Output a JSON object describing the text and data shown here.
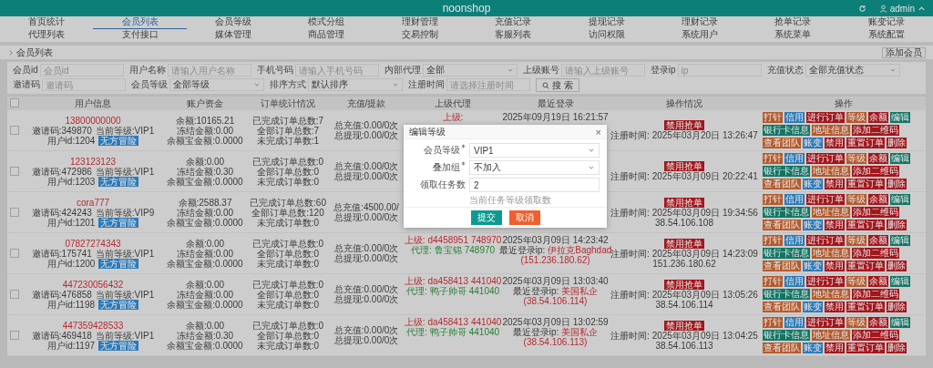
{
  "header": {
    "brand": "noonshop",
    "user": "admin"
  },
  "nav": [
    {
      "label": "首页统计",
      "selected": false
    },
    {
      "label": "会员列表",
      "selected": true
    },
    {
      "label": "会员等级",
      "selected": false
    },
    {
      "label": "模式分组",
      "selected": false
    },
    {
      "label": "理财管理",
      "selected": false
    },
    {
      "label": "充值记录",
      "selected": false
    },
    {
      "label": "提现记录",
      "selected": false
    },
    {
      "label": "理财记录",
      "selected": false
    },
    {
      "label": "抢单记录",
      "selected": false
    },
    {
      "label": "账变记录",
      "selected": false
    },
    {
      "label": "代理列表",
      "selected": false
    },
    {
      "label": "支付接口",
      "selected": false
    },
    {
      "label": "媒体管理",
      "selected": false
    },
    {
      "label": "商品管理",
      "selected": false
    },
    {
      "label": "交易控制",
      "selected": false
    },
    {
      "label": "客服列表",
      "selected": false
    },
    {
      "label": "访问权限",
      "selected": false
    },
    {
      "label": "系统用户",
      "selected": false
    },
    {
      "label": "系统菜单",
      "selected": false
    },
    {
      "label": "系统配置",
      "selected": false
    }
  ],
  "breadcrumb": "会员列表",
  "add_button": "添加会员",
  "filters": [
    {
      "label": "会员id",
      "kind": "input",
      "placeholder": "会员id"
    },
    {
      "label": "用户名称",
      "kind": "input",
      "placeholder": "请输入用户名称"
    },
    {
      "label": "手机号码",
      "kind": "input",
      "placeholder": "请输入手机号码"
    },
    {
      "label": "内部代理",
      "kind": "select",
      "value": "全部"
    },
    {
      "label": "上级账号",
      "kind": "input",
      "placeholder": "请输入上级账号"
    },
    {
      "label": "登录ip",
      "kind": "input",
      "placeholder": "ip"
    },
    {
      "label": "充值状态",
      "kind": "select",
      "value": "全部充值状态"
    },
    {
      "label": "邀请码",
      "kind": "input",
      "placeholder": "邀请码"
    },
    {
      "label": "会员等级",
      "kind": "select",
      "value": "全部等级"
    },
    {
      "label": "排序方式",
      "kind": "select",
      "value": "默认排序"
    },
    {
      "label": "注册时间",
      "kind": "input",
      "placeholder": "请选择注册时间"
    }
  ],
  "search_button": "搜 索",
  "table": {
    "all_checked": false,
    "columns": [
      "用户信息",
      "账户资金",
      "订单统计情况",
      "充值/提款",
      "上级代理",
      "最近登录",
      "操作情况",
      "操作"
    ],
    "rows": [
      {
        "checked": false,
        "phone": "13800000000",
        "info": [
          "邀请码:349870",
          "当前等级:VIP1",
          "用户id:1204"
        ],
        "badge": "无方冒险",
        "balance": [
          "余额:10165.21",
          "冻结金额:0.00",
          "余额宝金额:0.0000"
        ],
        "orders": [
          "已完成订单总数:7",
          "全部订单总数:7",
          "未完成订单数:1"
        ],
        "recharge": [
          "总充值:0.00/0次",
          "总提现:0.00/0次"
        ],
        "upper": {
          "up_label": "上级:"
        },
        "login": {
          "time": "2025年09月19日 16:21:57"
        },
        "ops": {
          "badge": "禁用抢单",
          "registered": "注册时间: 2025年03月20日 13:26:47"
        },
        "actions": [
          {
            "label": "打针",
            "color": "#b45a2c"
          },
          {
            "label": "信用",
            "color": "#2d7ab8"
          },
          {
            "label": "进行订单",
            "color": "#a3161c"
          },
          {
            "label": "等级",
            "color": "#b45a2c"
          },
          {
            "label": "余额",
            "color": "#a3161c"
          },
          {
            "label": "编辑",
            "color": "#127564"
          },
          {
            "label": "银行卡信息",
            "color": "#127564"
          },
          {
            "label": "地址信息",
            "color": "#b45a2c"
          },
          {
            "label": "添加二维码",
            "color": "#a3161c"
          },
          {
            "label": "查看团队",
            "color": "#b45a2c"
          },
          {
            "label": "账变",
            "color": "#2d7ab8"
          },
          {
            "label": "禁用",
            "color": "#a3161c"
          },
          {
            "label": "重置订单",
            "color": "#a3161c"
          },
          {
            "label": "删除",
            "color": "#a3161c"
          }
        ]
      },
      {
        "checked": false,
        "phone": "123123123",
        "info": [
          "邀请码:472986",
          "当前等级:VIP1",
          "用户id:1203"
        ],
        "badge": "无方冒险",
        "balance": [
          "余额:0.00",
          "冻结金额:0.30",
          "余额宝金额:0.0000"
        ],
        "orders": [
          "已完成订单总数:0",
          "全部订单总数:0",
          "未完成订单数:0"
        ],
        "recharge": [
          "总充值:0.00/0次",
          "总提现:0.00/0次"
        ],
        "ops": {
          "badge": "禁用抢单",
          "registered": "注册时间: 2025年03月09日 20:22:41"
        },
        "actions": [
          {
            "label": "打针",
            "color": "#b45a2c"
          },
          {
            "label": "信用",
            "color": "#2d7ab8"
          },
          {
            "label": "进行订单",
            "color": "#a3161c"
          },
          {
            "label": "等级",
            "color": "#b45a2c"
          },
          {
            "label": "余额",
            "color": "#a3161c"
          },
          {
            "label": "编辑",
            "color": "#127564"
          },
          {
            "label": "银行卡信息",
            "color": "#127564"
          },
          {
            "label": "地址信息",
            "color": "#b45a2c"
          },
          {
            "label": "添加二维码",
            "color": "#a3161c"
          },
          {
            "label": "查看团队",
            "color": "#b45a2c"
          },
          {
            "label": "账变",
            "color": "#2d7ab8"
          },
          {
            "label": "禁用",
            "color": "#a3161c"
          },
          {
            "label": "重置订单",
            "color": "#a3161c"
          },
          {
            "label": "删除",
            "color": "#a3161c"
          }
        ]
      },
      {
        "checked": false,
        "phone": "cora777",
        "info": [
          "邀请码:424243",
          "当前等级:VIP9",
          "用户id:1201"
        ],
        "badge": "无方冒险",
        "balance": [
          "余额:2588.37",
          "冻结金额:0.00",
          "余额宝金额:0.0000"
        ],
        "orders": [
          "已完成订单总数:60",
          "全部订单总数:120",
          "未完成订单数:0"
        ],
        "recharge": [
          "总充值:4500.00/",
          "总提现:0.00/0次"
        ],
        "ops": {
          "badge": "禁用抢单",
          "registered": "注册时间: 2025年03月09日 19:34:56",
          "ip": "38.54.106.108"
        },
        "actions": [
          {
            "label": "打针",
            "color": "#b45a2c"
          },
          {
            "label": "信用",
            "color": "#2d7ab8"
          },
          {
            "label": "进行订单",
            "color": "#a3161c"
          },
          {
            "label": "等级",
            "color": "#b45a2c"
          },
          {
            "label": "余额",
            "color": "#a3161c"
          },
          {
            "label": "编辑",
            "color": "#127564"
          },
          {
            "label": "银行卡信息",
            "color": "#127564"
          },
          {
            "label": "地址信息",
            "color": "#b45a2c"
          },
          {
            "label": "添加二维码",
            "color": "#a3161c"
          },
          {
            "label": "查看团队",
            "color": "#b45a2c"
          },
          {
            "label": "账变",
            "color": "#2d7ab8"
          },
          {
            "label": "禁用",
            "color": "#a3161c"
          },
          {
            "label": "重置订单",
            "color": "#a3161c"
          },
          {
            "label": "删除",
            "color": "#a3161c"
          }
        ]
      },
      {
        "checked": false,
        "phone": "07827274343",
        "info": [
          "邀请码:175741",
          "当前等级:VIP1",
          "用户id:1200"
        ],
        "badge": "无方冒险",
        "balance": [
          "余额:0.00",
          "冻结金额:0.00",
          "余额宝金额:0.0000"
        ],
        "orders": [
          "已完成订单总数:0",
          "全部订单总数:0",
          "未完成订单数:0"
        ],
        "recharge": [
          "总充值:0.00/0次",
          "总提现:0.00/0次"
        ],
        "upper": {
          "up_label": "上级:",
          "up_codes": [
            "d4458951",
            "748970"
          ],
          "agent_label": "代理:",
          "agent_codes": [
            "鲁宝锦",
            "748970"
          ]
        },
        "login": {
          "time": "2025年03月09日 14:23:42",
          "ip_label": "最近登录ip:",
          "location": "伊拉克Baghdad",
          "ip": "(151.236.180.62)"
        },
        "ops": {
          "badge": "禁用抢单",
          "registered": "注册时间: 2025年03月09日 14:23:09",
          "ip": "151.236.180.62"
        },
        "actions": [
          {
            "label": "打针",
            "color": "#b45a2c"
          },
          {
            "label": "信用",
            "color": "#2d7ab8"
          },
          {
            "label": "进行订单",
            "color": "#a3161c"
          },
          {
            "label": "等级",
            "color": "#b45a2c"
          },
          {
            "label": "余额",
            "color": "#a3161c"
          },
          {
            "label": "编辑",
            "color": "#127564"
          },
          {
            "label": "银行卡信息",
            "color": "#127564"
          },
          {
            "label": "地址信息",
            "color": "#b45a2c"
          },
          {
            "label": "添加二维码",
            "color": "#a3161c"
          },
          {
            "label": "查看团队",
            "color": "#b45a2c"
          },
          {
            "label": "账变",
            "color": "#2d7ab8"
          },
          {
            "label": "禁用",
            "color": "#a3161c"
          },
          {
            "label": "重置订单",
            "color": "#a3161c"
          },
          {
            "label": "删除",
            "color": "#a3161c"
          }
        ]
      },
      {
        "checked": false,
        "phone": "447230056432",
        "info": [
          "邀请码:476858",
          "当前等级:VIP1",
          "用户id:1198"
        ],
        "badge": "无方冒险",
        "balance": [
          "余额:0.00",
          "冻结金额:0.00",
          "余额宝金额:0.0000"
        ],
        "orders": [
          "已完成订单总数:0",
          "全部订单总数:0",
          "未完成订单数:0"
        ],
        "recharge": [
          "总充值:0.00/0次",
          "总提现:0.00/0次"
        ],
        "upper": {
          "up_label": "上级:",
          "up_codes": [
            "da458413",
            "441040"
          ],
          "agent_label": "代理:",
          "agent_codes": [
            "鸭子帅哥",
            "441040"
          ]
        },
        "login": {
          "time": "2025年03月09日 13:03:40",
          "ip_label": "最近登录ip:",
          "location": "美国私企",
          "ip": "(38.54.106.114)"
        },
        "ops": {
          "badge": "禁用抢单",
          "registered": "注册时间: 2025年03月09日 13:05:26",
          "ip": "38.54.106.114"
        },
        "actions": [
          {
            "label": "打针",
            "color": "#b45a2c"
          },
          {
            "label": "信用",
            "color": "#2d7ab8"
          },
          {
            "label": "进行订单",
            "color": "#a3161c"
          },
          {
            "label": "等级",
            "color": "#b45a2c"
          },
          {
            "label": "余额",
            "color": "#a3161c"
          },
          {
            "label": "编辑",
            "color": "#127564"
          },
          {
            "label": "银行卡信息",
            "color": "#127564"
          },
          {
            "label": "地址信息",
            "color": "#b45a2c"
          },
          {
            "label": "添加二维码",
            "color": "#a3161c"
          },
          {
            "label": "查看团队",
            "color": "#b45a2c"
          },
          {
            "label": "账变",
            "color": "#2d7ab8"
          },
          {
            "label": "禁用",
            "color": "#a3161c"
          },
          {
            "label": "重置订单",
            "color": "#a3161c"
          },
          {
            "label": "删除",
            "color": "#a3161c"
          }
        ]
      },
      {
        "checked": false,
        "phone": "447359428533",
        "info": [
          "邀请码:469418",
          "当前等级:VIP1",
          "用户id:1197"
        ],
        "badge": "无方冒险",
        "balance": [
          "余额:0.00",
          "冻结金额:0.30",
          "余额宝金额:0.0000"
        ],
        "orders": [
          "已完成订单总数:0",
          "全部订单总数:0",
          "未完成订单数:0"
        ],
        "recharge": [
          "总充值:0.00/0次",
          "总提现:0.00/0次"
        ],
        "upper": {
          "up_label": "上级:",
          "up_codes": [
            "da458413",
            "441040"
          ],
          "agent_label": "代理:",
          "agent_codes": [
            "鸭子帅哥",
            "441040"
          ]
        },
        "login": {
          "time": "2025年03月09日 13:02:59",
          "ip_label": "最近登录ip:",
          "location": "美国私企",
          "ip": "(38.54.106.113)"
        },
        "ops": {
          "badge": "禁用抢单",
          "registered": "注册时间: 2025年03月09日 13:04:25",
          "ip": "38.54.106.113"
        },
        "actions": [
          {
            "label": "打针",
            "color": "#b45a2c"
          },
          {
            "label": "信用",
            "color": "#2d7ab8"
          },
          {
            "label": "进行订单",
            "color": "#a3161c"
          },
          {
            "label": "等级",
            "color": "#b45a2c"
          },
          {
            "label": "余额",
            "color": "#a3161c"
          },
          {
            "label": "编辑",
            "color": "#127564"
          },
          {
            "label": "银行卡信息",
            "color": "#127564"
          },
          {
            "label": "地址信息",
            "color": "#b45a2c"
          },
          {
            "label": "添加二维码",
            "color": "#a3161c"
          },
          {
            "label": "查看团队",
            "color": "#b45a2c"
          },
          {
            "label": "账变",
            "color": "#2d7ab8"
          },
          {
            "label": "禁用",
            "color": "#a3161c"
          },
          {
            "label": "重置订单",
            "color": "#a3161c"
          },
          {
            "label": "删除",
            "color": "#a3161c"
          }
        ]
      }
    ]
  },
  "modal": {
    "title": "编辑等级",
    "close": "×",
    "fields": [
      {
        "label": "会员等级",
        "required": true,
        "kind": "select",
        "value": "VIP1"
      },
      {
        "label": "叠加组",
        "required": true,
        "kind": "select",
        "value": "不加入"
      },
      {
        "label": "领取任务数",
        "required": false,
        "kind": "input",
        "value": "2"
      }
    ],
    "hint": "当前任务等级领取数",
    "buttons": [
      {
        "label": "提交",
        "kind": "primary"
      },
      {
        "label": "取消",
        "kind": "danger"
      }
    ]
  }
}
